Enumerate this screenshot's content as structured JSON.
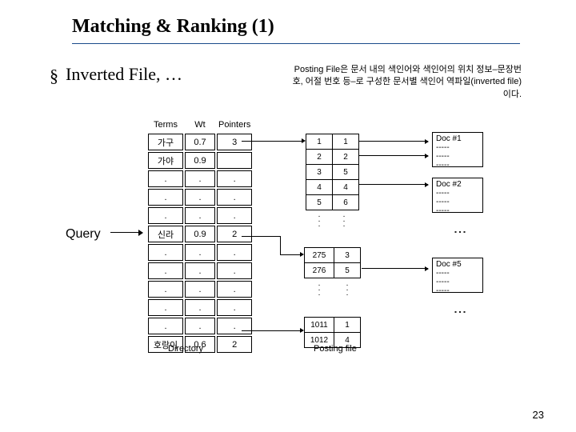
{
  "title": "Matching & Ranking (1)",
  "subheading": "Inverted File, …",
  "bullet": "§",
  "description": "Posting File은 문서 내의 색인어와 색인어의 위치 정보–문장번호, 어절 번호 등–로 구성한 문서별 색인어 역파일(inverted file)이다.",
  "query_label": "Query",
  "dir_headers": {
    "terms": "Terms",
    "wt": "Wt",
    "ptr": "Pointers"
  },
  "dir_rows": [
    {
      "t": "가구",
      "w": "0.7",
      "p": "3"
    },
    {
      "t": "가야",
      "w": "0.9",
      "p": ""
    },
    {
      "t": ".",
      "w": ".",
      "p": "."
    },
    {
      "t": ".",
      "w": ".",
      "p": "."
    },
    {
      "t": ".",
      "w": ".",
      "p": "."
    },
    {
      "t": "신라",
      "w": "0.9",
      "p": "2"
    },
    {
      "t": ".",
      "w": ".",
      "p": "."
    },
    {
      "t": ".",
      "w": ".",
      "p": "."
    },
    {
      "t": ".",
      "w": ".",
      "p": "."
    },
    {
      "t": ".",
      "w": ".",
      "p": "."
    },
    {
      "t": ".",
      "w": ".",
      "p": "."
    },
    {
      "t": "호랑이",
      "w": "0.6",
      "p": "2"
    }
  ],
  "dir_label": "Directory",
  "posting": {
    "block1": {
      "col1": [
        "1",
        "2",
        "3",
        "4",
        "5"
      ],
      "col2": [
        "1",
        "2",
        "5",
        "4",
        "6"
      ]
    },
    "block2": {
      "col1": [
        "275",
        "276"
      ],
      "col2": [
        "3",
        "5"
      ]
    },
    "block3": {
      "col1": [
        "1011",
        "1012"
      ],
      "col2": [
        "1",
        "4"
      ]
    }
  },
  "posting_label": "Posting file",
  "docs": [
    {
      "title": "Doc #1",
      "lines": [
        "-----",
        "-----",
        "-----"
      ]
    },
    {
      "title": "Doc #2",
      "lines": [
        "-----",
        "-----",
        "-----"
      ]
    },
    {
      "title": "Doc #5",
      "lines": [
        "-----",
        "-----",
        "-----"
      ]
    }
  ],
  "doc_ellipsis": "⋮",
  "page_number": "23"
}
